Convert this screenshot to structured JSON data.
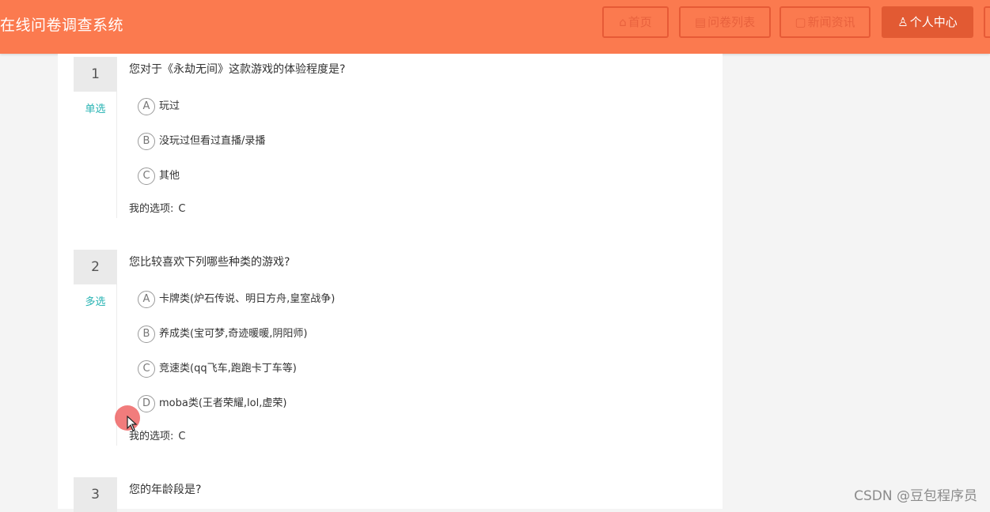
{
  "header": {
    "site_title": "在线问卷调查系统",
    "nav": [
      {
        "icon": "home-icon",
        "label": "首页"
      },
      {
        "icon": "list-icon",
        "label": "问卷列表"
      },
      {
        "icon": "news-icon",
        "label": "新闻资讯"
      },
      {
        "icon": "user-icon",
        "label": "个人中心"
      }
    ]
  },
  "questions": [
    {
      "number": "1",
      "type": "单选",
      "title": "您对于《永劫无间》这款游戏的体验程度是?",
      "options": [
        {
          "letter": "A",
          "text": "玩过"
        },
        {
          "letter": "B",
          "text": "没玩过但看过直播/录播"
        },
        {
          "letter": "C",
          "text": "其他"
        }
      ],
      "answer_label": "我的选项:",
      "answer_value": "C"
    },
    {
      "number": "2",
      "type": "多选",
      "title": "您比较喜欢下列哪些种类的游戏?",
      "options": [
        {
          "letter": "A",
          "text": "卡牌类(炉石传说、明日方舟,皇室战争)"
        },
        {
          "letter": "B",
          "text": "养成类(宝可梦,奇迹暖暖,阴阳师)"
        },
        {
          "letter": "C",
          "text": "竞速类(qq飞车,跑跑卡丁车等)"
        },
        {
          "letter": "D",
          "text": "moba类(王者荣耀,lol,虚荣)"
        }
      ],
      "answer_label": "我的选项:",
      "answer_value": "C"
    },
    {
      "number": "3",
      "title": "您的年龄段是?"
    }
  ],
  "watermark": "CSDN @豆包程序员",
  "colors": {
    "header_bg": "#fb7a4f",
    "nav_border": "#e65a36",
    "nav_active_bg": "#e25a33",
    "type_label": "#27b3b3"
  }
}
